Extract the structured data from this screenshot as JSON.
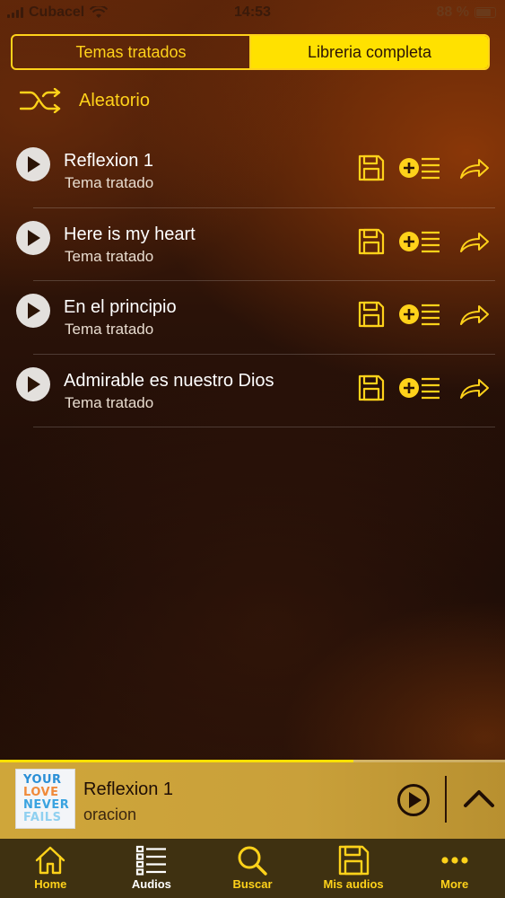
{
  "status_bar": {
    "carrier": "Cubacel",
    "time": "14:53",
    "battery": "88 %"
  },
  "segment": {
    "left_label": "Temas tratados",
    "right_label": "Libreria completa",
    "selected": "right"
  },
  "shuffle": {
    "label": "Aleatorio",
    "icon": "shuffle-icon"
  },
  "tracks": [
    {
      "title": "Reflexion 1",
      "subtitle": "Tema tratado"
    },
    {
      "title": "Here is my heart",
      "subtitle": "Tema tratado"
    },
    {
      "title": "En el principio",
      "subtitle": "Tema tratado"
    },
    {
      "title": "Admirable es nuestro Dios",
      "subtitle": "Tema tratado"
    }
  ],
  "row_actions": [
    "floppy-save-icon",
    "add-to-queue-icon",
    "share-arrow-icon"
  ],
  "now_playing": {
    "title": "Reflexion 1",
    "subtitle": "oracion",
    "progress": 0.7,
    "album_art_text": [
      "YOUR",
      "LOVE",
      "NEVER",
      "FAILS"
    ]
  },
  "tabbar": {
    "items": [
      {
        "label": "Home",
        "icon": "home-icon",
        "active": false
      },
      {
        "label": "Audios",
        "icon": "list-icon",
        "active": true
      },
      {
        "label": "Buscar",
        "icon": "search-icon",
        "active": false
      },
      {
        "label": "Mis audios",
        "icon": "floppy-icon",
        "active": false
      },
      {
        "label": "More",
        "icon": "more-icon",
        "active": false
      }
    ]
  },
  "colors": {
    "accent": "#ffd21a",
    "segment_active": "#ffe100",
    "player_bg": "#cfa63a",
    "tabbar_bg": "#3f3111"
  }
}
